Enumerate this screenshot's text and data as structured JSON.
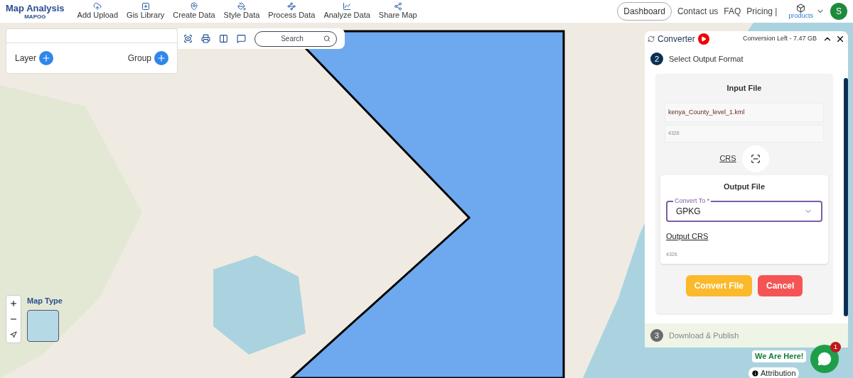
{
  "brand": {
    "title": "Map Analysis",
    "subtitle": "MAPOG"
  },
  "nav": [
    {
      "label": "Add Upload"
    },
    {
      "label": "Gis Library"
    },
    {
      "label": "Create Data"
    },
    {
      "label": "Style Data"
    },
    {
      "label": "Process Data"
    },
    {
      "label": "Analyze Data"
    },
    {
      "label": "Share Map"
    }
  ],
  "right_nav": {
    "dashboard": "Dashboard",
    "links": [
      "Contact us",
      "FAQ",
      "Pricing |"
    ],
    "products": "products",
    "avatar": "S"
  },
  "layer_panel": {
    "layer": "Layer",
    "group": "Group"
  },
  "map_toolbar": {
    "search_placeholder": "Search"
  },
  "converter": {
    "title": "Converter",
    "conversion_left": "Conversion Left - 7.47 GB",
    "step_current": {
      "number": "2",
      "label": "Select Output Format",
      "active": true
    },
    "input_file": {
      "title": "Input File",
      "filename": "kenya_County_level_1.kml",
      "crs_code": "4326",
      "crs_label": "CRS"
    },
    "output_file": {
      "title": "Output File",
      "convert_to_label": "Convert To *",
      "convert_to_value": "GPKG",
      "output_crs_label": "Output CRS",
      "crs_code": "4326"
    },
    "buttons": [
      {
        "label": "Convert File",
        "kind": "primary"
      },
      {
        "label": "Cancel",
        "kind": "danger"
      }
    ],
    "step_next": {
      "number": "3",
      "label": "Download & Publish",
      "active": false
    }
  },
  "map_controls": {
    "map_type_label": "Map Type"
  },
  "chat": {
    "tagline": "We Are Here!",
    "badge": "1"
  },
  "attribution": "Attribution"
}
